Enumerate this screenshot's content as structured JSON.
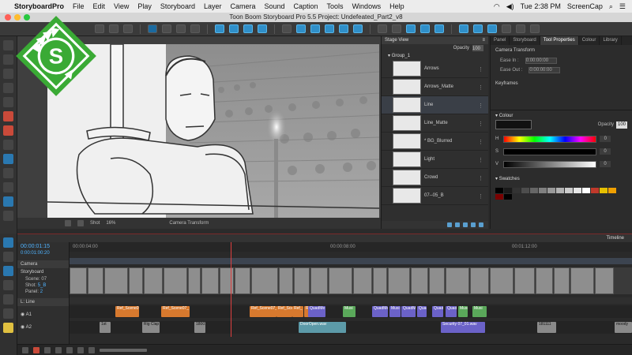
{
  "menubar": {
    "app": "StoryboardPro",
    "items": [
      "File",
      "Edit",
      "View",
      "Play",
      "Storyboard",
      "Layer",
      "Camera",
      "Sound",
      "Caption",
      "Tools",
      "Windows",
      "Help"
    ],
    "clock": "Tue 2:38 PM",
    "screencap": "ScreenCap"
  },
  "window": {
    "title": "Toon Boom Storyboard Pro 5.5 Project: Undefeated_Part2_v8"
  },
  "stage": {
    "panel_title": "Stage View",
    "bottom_label": "Camera Transform",
    "shot_label": "Shot",
    "zoom": "16%"
  },
  "layers": {
    "opacity_label": "Opacity",
    "opacity_value": "100",
    "group": "Group_1",
    "rows": [
      {
        "name": "Arrows"
      },
      {
        "name": "Arrows_Matte"
      },
      {
        "name": "Line"
      },
      {
        "name": "Line_Matte"
      },
      {
        "name": "* BG_Blurred"
      },
      {
        "name": "Light"
      },
      {
        "name": "Crowd"
      },
      {
        "name": "07--05_B"
      }
    ]
  },
  "props": {
    "tabs": [
      "Panel",
      "Storyboard",
      "Tool Properties",
      "Colour",
      "Library"
    ],
    "active_tab": "Tool Properties",
    "camera_transform": "Camera Transform",
    "ease_in": "Ease In :",
    "ease_out": "Ease Out :",
    "ease_in_value": "0:00:00:00",
    "ease_out_value": "0:00:00:00",
    "keyframes": "Keyframes",
    "colour_title": "Colour",
    "opacity_label": "Opacity",
    "opacity_value": "100",
    "h": "H",
    "s": "S",
    "v": "V",
    "h_val": "0",
    "s_val": "0",
    "v_val": "0",
    "swatches_title": "Swatches",
    "swatch_colors": [
      "#000000",
      "#1a1a1a",
      "#333333",
      "#4d4d4d",
      "#666666",
      "#808080",
      "#999999",
      "#b3b3b3",
      "#cccccc",
      "#e6e6e6",
      "#ffffff",
      "#c0392b",
      "#e6c000",
      "#f0a000",
      "#7a0000",
      "#000000"
    ]
  },
  "timeline": {
    "title": "Timeline",
    "timecode": "00:00:01:15",
    "timecode2": "0:00:01:00:20",
    "camera_label": "Camera",
    "storyboard_label": "Storyboard",
    "scene": "Scene:",
    "scene_val": "07",
    "shot": "Shot:",
    "shot_val": "5_B",
    "panel": "Panel:",
    "panel_val": "2",
    "layer_label": "L: Line",
    "a1": "A1",
    "a2": "A2",
    "ruler": [
      "00:00:04:00",
      "00:00:08:00",
      "00:01:12:00"
    ],
    "a1_clips": [
      {
        "label": "Ref_Scene07_",
        "color": "orange"
      },
      {
        "label": "Ref_Scene07_",
        "color": "orange"
      },
      {
        "label": "Ref_Scene07_",
        "color": "orange"
      },
      {
        "label": "Ref_Scene07_",
        "color": "orange"
      },
      {
        "label": "Ref_",
        "color": "orange"
      },
      {
        "label": "Ref_S",
        "color": "orange"
      },
      {
        "label": "QuadMe",
        "color": "purple"
      },
      {
        "label": "Musi",
        "color": "green"
      },
      {
        "label": "QuadMe",
        "color": "purple"
      },
      {
        "label": "Musi 2",
        "color": "purple"
      },
      {
        "label": "QuadMe",
        "color": "purple"
      },
      {
        "label": "QuadMe",
        "color": "purple"
      },
      {
        "label": "QuadMe",
        "color": "purple"
      },
      {
        "label": "QuadMe",
        "color": "purple"
      },
      {
        "label": "Musi Sca",
        "color": "green"
      },
      {
        "label": "Musi",
        "color": "green"
      }
    ],
    "a2_clips": [
      {
        "label": "1st",
        "color": "grey"
      },
      {
        "label": "Rig Clap",
        "color": "grey"
      },
      {
        "label": "18001",
        "color": "grey"
      },
      {
        "label": "DoorOpen.wav",
        "color": "teal"
      },
      {
        "label": "Security 07_01.wav",
        "color": "purple"
      },
      {
        "label": "181111",
        "color": "grey"
      },
      {
        "label": "moody",
        "color": "grey"
      }
    ],
    "a2_sub": "18001"
  }
}
